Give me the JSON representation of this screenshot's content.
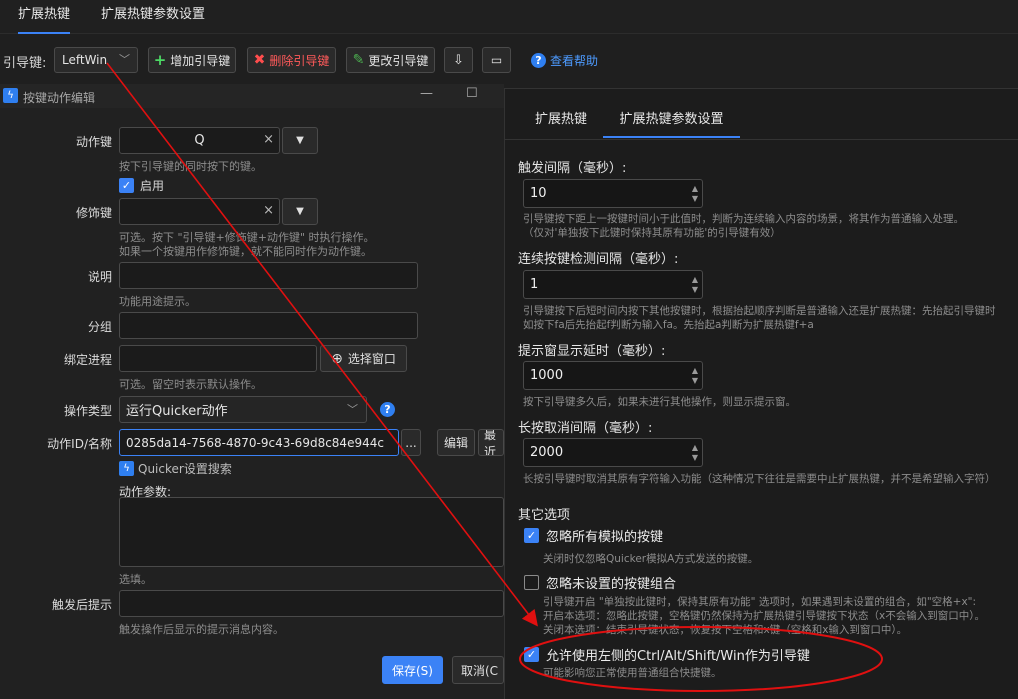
{
  "top_tabs": [
    "扩展热键",
    "扩展热键参数设置"
  ],
  "toolbar": {
    "guide_label": "引导键:",
    "guide_value": "LeftWin",
    "add_label": "增加引导键",
    "delete_label": "删除引导键",
    "edit_label": "更改引导键",
    "help_label": "查看帮助"
  },
  "dialog": {
    "title": "按键动作编辑",
    "action_key_label": "动作键",
    "action_key_value": "Q",
    "action_key_hint": "按下引导键的同时按下的键。",
    "enable_label": "启用",
    "modifier_label": "修饰键",
    "modifier_hint1": "可选。按下 \"引导键+修饰键+动作键\" 时执行操作。",
    "modifier_hint2": "如果一个按键用作修饰键，就不能同时作为动作键。",
    "desc_label": "说明",
    "desc_hint": "功能用途提示。",
    "group_label": "分组",
    "process_label": "绑定进程",
    "choose_window": "选择窗口",
    "process_hint": "可选。留空时表示默认操作。",
    "op_type_label": "操作类型",
    "op_type_value": "运行Quicker动作",
    "action_id_label": "动作ID/名称",
    "action_id_value": "0285da14-7568-4870-9c43-69d8c84e944c",
    "more_btn": "...",
    "edit_btn": "编辑",
    "latest_btn": "最近",
    "quicker_link": "Quicker设置搜索",
    "params_label": "动作参数:",
    "params_hint": "选填。",
    "after_label": "触发后提示",
    "after_hint": "触发操作后显示的提示消息内容。",
    "save_btn": "保存(S)",
    "cancel_btn": "取消(C"
  },
  "panel": {
    "tabs": [
      "扩展热键",
      "扩展热键参数设置"
    ],
    "interval_label": "触发间隔（毫秒）:",
    "interval_value": "10",
    "interval_hint1": "引导键按下距上一按键时间小于此值时，判断为连续输入内容的场景，将其作为普通输入处理。",
    "interval_hint2": "（仅对'单独按下此键时保持其原有功能'的引导键有效）",
    "detect_label": "连续按键检测间隔（毫秒）:",
    "detect_value": "1",
    "detect_hint1": "引导键按下后短时间内按下其他按键时，根据抬起顺序判断是普通输入还是扩展热键：先抬起引导键时",
    "detect_hint2": "如按下fa后先抬起f判断为输入fa。先抬起a判断为扩展热键f+a",
    "delay_label": "提示窗显示延时（毫秒）:",
    "delay_value": "1000",
    "delay_hint": "按下引导键多久后，如果未进行其他操作，则显示提示窗。",
    "longpress_label": "长按取消间隔（毫秒）:",
    "longpress_value": "2000",
    "longpress_hint": "长按引导键时取消其原有字符输入功能（这种情况下往往是需要中止扩展热键，并不是希望输入字符）",
    "other_label": "其它选项",
    "opt1_label": "忽略所有模拟的按键",
    "opt1_desc": "关闭时仅忽略Quicker模拟A方式发送的按键。",
    "opt2_label": "忽略未设置的按键组合",
    "opt2_desc1": "引导键开启 \"单独按此键时，保持其原有功能\" 选项时，如果遇到未设置的组合，如\"空格+x\":",
    "opt2_desc2": "开启本选项：忽略此按键，空格键仍然保持为扩展热键引导键按下状态（x不会输入到窗口中）。",
    "opt2_desc3": "关闭本选项：结束引导键状态，恢复按下空格和x键（空格和x输入到窗口中）。",
    "opt3_label": "允许使用左侧的Ctrl/Alt/Shift/Win作为引导键",
    "opt3_desc": "可能影响您正常使用普通组合快捷键。"
  },
  "colors": {
    "accent": "#3b82f6",
    "annotation": "#e01010"
  }
}
